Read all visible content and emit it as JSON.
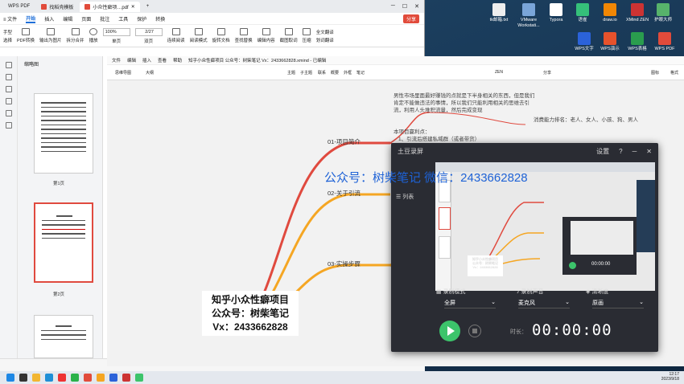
{
  "wps": {
    "tabs": [
      "WPS PDF",
      "找稻壳模板",
      "小众性癖项…pdf"
    ],
    "add_tab": "+",
    "menu": [
      "≡ 文件",
      "开始",
      "插入",
      "编辑",
      "页面",
      "批注",
      "工具",
      "保护",
      "转换"
    ],
    "share": "分享",
    "toolbar": [
      "手型",
      "选择",
      "PDF转换",
      "输出为图片",
      "拆分合并",
      "播放",
      "单页",
      "双页",
      "连续阅读",
      "阅读模式",
      "旋转文档",
      "查找替换",
      "编辑内容",
      "截图取词",
      "压缩",
      "全文翻译",
      "划词翻译"
    ],
    "zoom": "100%",
    "page": "2/27",
    "sidebar_title": "缩略图",
    "pages": [
      "第1页",
      "第2页"
    ],
    "zoom_status": "100%"
  },
  "doc": {
    "menu": [
      "文件",
      "编辑",
      "插入",
      "查看",
      "帮助"
    ],
    "filename": "知乎小众性癖项目 公众号：树柴笔记 Vx：2433662828.xmind - 已编辑",
    "tools": [
      "思维导图",
      "大纲",
      "主题",
      "子主题",
      "联系",
      "概要",
      "外框",
      "笔记",
      "ZEN",
      "分享",
      "图标",
      "格式"
    ]
  },
  "mindmap": {
    "topics": [
      "01-项目简介",
      "02-关于引流",
      "03-实操步骤"
    ],
    "note1": "男性市场里面最好赚钱的点就是下半身相关的东西，但是我们肯定不能做违法的事情，所以我们只能利用相关的思维去引流，利用人头堆积流量，然后完成变现",
    "note2": "本项目赢利点：",
    "note3": "1、引流后搭建私域群（或者带货）",
    "note4": "消费能力排名：老人、女人、小孩、狗、男人",
    "center": [
      "知乎小众性癖项目",
      "公众号：树柴笔记",
      "Vx：2433662828"
    ]
  },
  "recorder": {
    "title": "土豆录屏",
    "settings": "设置",
    "list": "列表",
    "mode_label": "录制模式",
    "mode_value": "全屏",
    "audio_label": "录制声音",
    "audio_value": "麦克风",
    "quality_label": "清晰度",
    "quality_value": "原画",
    "duration_label": "时长：",
    "timer": "00:00:00",
    "preview_brand": [
      "知乎小众性癖项目",
      "公众号：树柴笔记",
      "Vx：2433662828"
    ],
    "preview_timer": "00:00:00"
  },
  "watermark": "公众号：树柴笔记   微信：2433662828",
  "desktop": {
    "icons": [
      "tk邮箱.txt",
      "VMware Workstati...",
      "Typora",
      "语雀",
      "draw.io",
      "XMind ZEN",
      "护眼大师",
      "WPS文字",
      "WPS演示",
      "WPS表格",
      "WPS PDF"
    ]
  },
  "taskbar": {
    "time": "12:17",
    "date": "2023/9/18"
  },
  "colors": {
    "accent": "#1e6fd9",
    "branch_red": "#e04a3f",
    "branch_orange": "#f5a623",
    "recorder_bg": "#2a2c33",
    "record_green": "#3cc46b"
  }
}
